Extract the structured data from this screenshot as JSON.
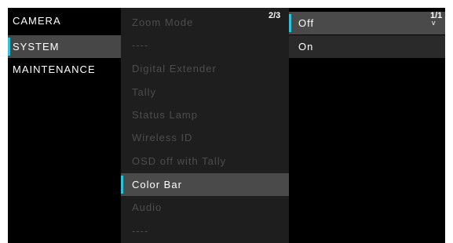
{
  "menu_main": {
    "items": [
      {
        "label": "CAMERA"
      },
      {
        "label": "SYSTEM"
      },
      {
        "label": "MAINTENANCE"
      }
    ]
  },
  "menu_system": {
    "page": "2/3",
    "items": [
      {
        "label": "Zoom Mode"
      },
      {
        "label": "----"
      },
      {
        "label": "Digital Extender"
      },
      {
        "label": "Tally"
      },
      {
        "label": "Status Lamp"
      },
      {
        "label": "Wireless ID"
      },
      {
        "label": "OSD off with Tally"
      },
      {
        "label": "Color Bar"
      },
      {
        "label": "Audio"
      },
      {
        "label": "----"
      }
    ]
  },
  "menu_options": {
    "page": "1/1",
    "items": [
      {
        "label": "Off"
      },
      {
        "label": "On"
      }
    ]
  }
}
